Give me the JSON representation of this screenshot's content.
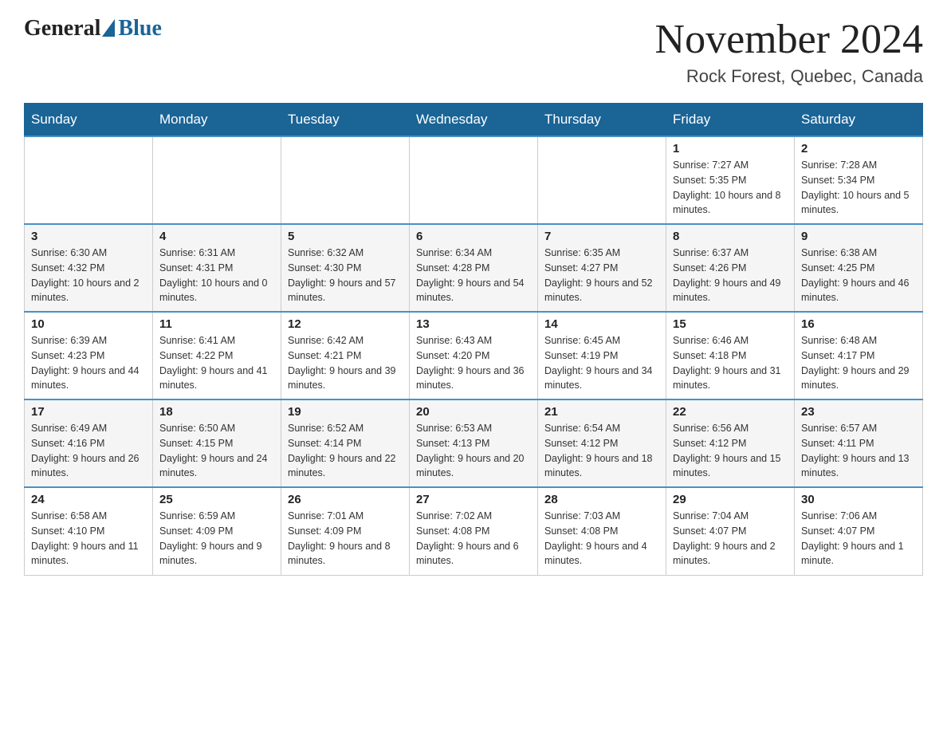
{
  "header": {
    "logo_general": "General",
    "logo_blue": "Blue",
    "month_title": "November 2024",
    "location": "Rock Forest, Quebec, Canada"
  },
  "days_of_week": [
    "Sunday",
    "Monday",
    "Tuesday",
    "Wednesday",
    "Thursday",
    "Friday",
    "Saturday"
  ],
  "weeks": [
    {
      "days": [
        {
          "number": "",
          "info": ""
        },
        {
          "number": "",
          "info": ""
        },
        {
          "number": "",
          "info": ""
        },
        {
          "number": "",
          "info": ""
        },
        {
          "number": "",
          "info": ""
        },
        {
          "number": "1",
          "info": "Sunrise: 7:27 AM\nSunset: 5:35 PM\nDaylight: 10 hours and 8 minutes."
        },
        {
          "number": "2",
          "info": "Sunrise: 7:28 AM\nSunset: 5:34 PM\nDaylight: 10 hours and 5 minutes."
        }
      ]
    },
    {
      "days": [
        {
          "number": "3",
          "info": "Sunrise: 6:30 AM\nSunset: 4:32 PM\nDaylight: 10 hours and 2 minutes."
        },
        {
          "number": "4",
          "info": "Sunrise: 6:31 AM\nSunset: 4:31 PM\nDaylight: 10 hours and 0 minutes."
        },
        {
          "number": "5",
          "info": "Sunrise: 6:32 AM\nSunset: 4:30 PM\nDaylight: 9 hours and 57 minutes."
        },
        {
          "number": "6",
          "info": "Sunrise: 6:34 AM\nSunset: 4:28 PM\nDaylight: 9 hours and 54 minutes."
        },
        {
          "number": "7",
          "info": "Sunrise: 6:35 AM\nSunset: 4:27 PM\nDaylight: 9 hours and 52 minutes."
        },
        {
          "number": "8",
          "info": "Sunrise: 6:37 AM\nSunset: 4:26 PM\nDaylight: 9 hours and 49 minutes."
        },
        {
          "number": "9",
          "info": "Sunrise: 6:38 AM\nSunset: 4:25 PM\nDaylight: 9 hours and 46 minutes."
        }
      ]
    },
    {
      "days": [
        {
          "number": "10",
          "info": "Sunrise: 6:39 AM\nSunset: 4:23 PM\nDaylight: 9 hours and 44 minutes."
        },
        {
          "number": "11",
          "info": "Sunrise: 6:41 AM\nSunset: 4:22 PM\nDaylight: 9 hours and 41 minutes."
        },
        {
          "number": "12",
          "info": "Sunrise: 6:42 AM\nSunset: 4:21 PM\nDaylight: 9 hours and 39 minutes."
        },
        {
          "number": "13",
          "info": "Sunrise: 6:43 AM\nSunset: 4:20 PM\nDaylight: 9 hours and 36 minutes."
        },
        {
          "number": "14",
          "info": "Sunrise: 6:45 AM\nSunset: 4:19 PM\nDaylight: 9 hours and 34 minutes."
        },
        {
          "number": "15",
          "info": "Sunrise: 6:46 AM\nSunset: 4:18 PM\nDaylight: 9 hours and 31 minutes."
        },
        {
          "number": "16",
          "info": "Sunrise: 6:48 AM\nSunset: 4:17 PM\nDaylight: 9 hours and 29 minutes."
        }
      ]
    },
    {
      "days": [
        {
          "number": "17",
          "info": "Sunrise: 6:49 AM\nSunset: 4:16 PM\nDaylight: 9 hours and 26 minutes."
        },
        {
          "number": "18",
          "info": "Sunrise: 6:50 AM\nSunset: 4:15 PM\nDaylight: 9 hours and 24 minutes."
        },
        {
          "number": "19",
          "info": "Sunrise: 6:52 AM\nSunset: 4:14 PM\nDaylight: 9 hours and 22 minutes."
        },
        {
          "number": "20",
          "info": "Sunrise: 6:53 AM\nSunset: 4:13 PM\nDaylight: 9 hours and 20 minutes."
        },
        {
          "number": "21",
          "info": "Sunrise: 6:54 AM\nSunset: 4:12 PM\nDaylight: 9 hours and 18 minutes."
        },
        {
          "number": "22",
          "info": "Sunrise: 6:56 AM\nSunset: 4:12 PM\nDaylight: 9 hours and 15 minutes."
        },
        {
          "number": "23",
          "info": "Sunrise: 6:57 AM\nSunset: 4:11 PM\nDaylight: 9 hours and 13 minutes."
        }
      ]
    },
    {
      "days": [
        {
          "number": "24",
          "info": "Sunrise: 6:58 AM\nSunset: 4:10 PM\nDaylight: 9 hours and 11 minutes."
        },
        {
          "number": "25",
          "info": "Sunrise: 6:59 AM\nSunset: 4:09 PM\nDaylight: 9 hours and 9 minutes."
        },
        {
          "number": "26",
          "info": "Sunrise: 7:01 AM\nSunset: 4:09 PM\nDaylight: 9 hours and 8 minutes."
        },
        {
          "number": "27",
          "info": "Sunrise: 7:02 AM\nSunset: 4:08 PM\nDaylight: 9 hours and 6 minutes."
        },
        {
          "number": "28",
          "info": "Sunrise: 7:03 AM\nSunset: 4:08 PM\nDaylight: 9 hours and 4 minutes."
        },
        {
          "number": "29",
          "info": "Sunrise: 7:04 AM\nSunset: 4:07 PM\nDaylight: 9 hours and 2 minutes."
        },
        {
          "number": "30",
          "info": "Sunrise: 7:06 AM\nSunset: 4:07 PM\nDaylight: 9 hours and 1 minute."
        }
      ]
    }
  ]
}
